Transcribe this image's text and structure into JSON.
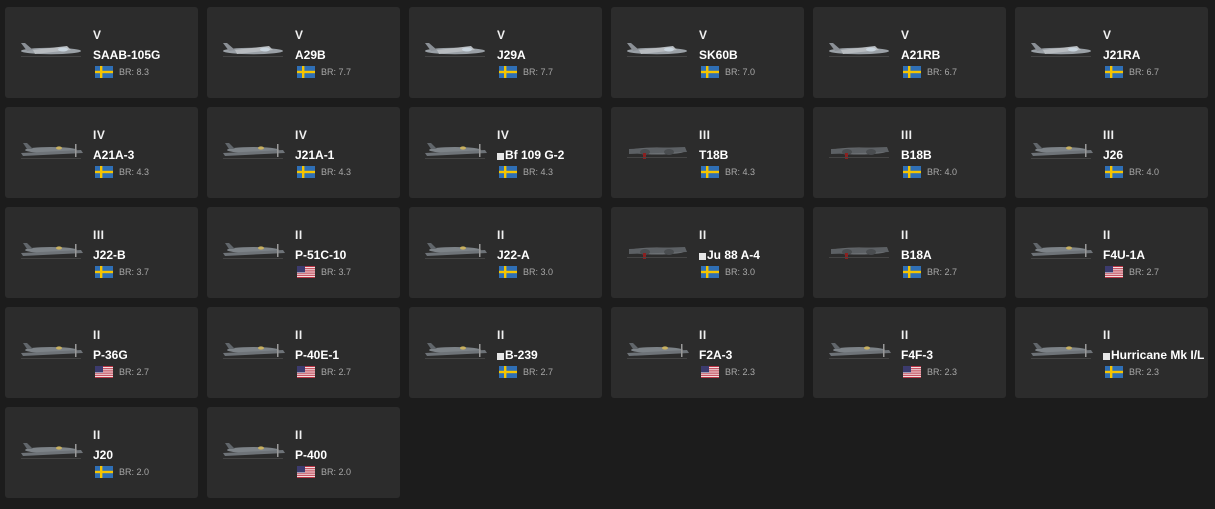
{
  "vehicles": [
    {
      "rank": "V",
      "name": "SAAB-105G",
      "premium": false,
      "flag": "sweden-flag-icon",
      "br": "BR: 8.3",
      "plane": "jet-icon"
    },
    {
      "rank": "V",
      "name": "A29B",
      "premium": false,
      "flag": "sweden-flag-icon",
      "br": "BR: 7.7",
      "plane": "jet-icon"
    },
    {
      "rank": "V",
      "name": "J29A",
      "premium": false,
      "flag": "sweden-flag-icon",
      "br": "BR: 7.7",
      "plane": "jet-icon"
    },
    {
      "rank": "V",
      "name": "SK60B",
      "premium": false,
      "flag": "sweden-flag-icon",
      "br": "BR: 7.0",
      "plane": "jet-icon"
    },
    {
      "rank": "V",
      "name": "A21RB",
      "premium": false,
      "flag": "sweden-flag-icon",
      "br": "BR: 6.7",
      "plane": "jet-icon"
    },
    {
      "rank": "V",
      "name": "J21RA",
      "premium": false,
      "flag": "sweden-flag-icon",
      "br": "BR: 6.7",
      "plane": "jet-icon"
    },
    {
      "rank": "IV",
      "name": "A21A-3",
      "premium": false,
      "flag": "sweden-flag-icon",
      "br": "BR: 4.3",
      "plane": "prop-plane-icon"
    },
    {
      "rank": "IV",
      "name": "J21A-1",
      "premium": false,
      "flag": "sweden-flag-icon",
      "br": "BR: 4.3",
      "plane": "prop-plane-icon"
    },
    {
      "rank": "IV",
      "name": "Bf 109 G-2",
      "premium": true,
      "flag": "sweden-flag-icon",
      "br": "BR: 4.3",
      "plane": "prop-plane-icon"
    },
    {
      "rank": "III",
      "name": "T18B",
      "premium": false,
      "flag": "sweden-flag-icon",
      "br": "BR: 4.3",
      "plane": "twin-engine-icon"
    },
    {
      "rank": "III",
      "name": "B18B",
      "premium": false,
      "flag": "sweden-flag-icon",
      "br": "BR: 4.0",
      "plane": "twin-engine-icon"
    },
    {
      "rank": "III",
      "name": "J26",
      "premium": false,
      "flag": "sweden-flag-icon",
      "br": "BR: 4.0",
      "plane": "prop-plane-icon"
    },
    {
      "rank": "III",
      "name": "J22-B",
      "premium": false,
      "flag": "sweden-flag-icon",
      "br": "BR: 3.7",
      "plane": "prop-plane-icon"
    },
    {
      "rank": "II",
      "name": "P-51C-10",
      "premium": false,
      "flag": "usa-flag-icon",
      "br": "BR: 3.7",
      "plane": "prop-plane-icon"
    },
    {
      "rank": "II",
      "name": "J22-A",
      "premium": false,
      "flag": "sweden-flag-icon",
      "br": "BR: 3.0",
      "plane": "prop-plane-icon"
    },
    {
      "rank": "II",
      "name": "Ju 88 A-4",
      "premium": true,
      "flag": "sweden-flag-icon",
      "br": "BR: 3.0",
      "plane": "twin-engine-icon"
    },
    {
      "rank": "II",
      "name": "B18A",
      "premium": false,
      "flag": "sweden-flag-icon",
      "br": "BR: 2.7",
      "plane": "twin-engine-icon"
    },
    {
      "rank": "II",
      "name": "F4U-1A",
      "premium": false,
      "flag": "usa-flag-icon",
      "br": "BR: 2.7",
      "plane": "prop-plane-icon"
    },
    {
      "rank": "II",
      "name": "P-36G",
      "premium": false,
      "flag": "usa-flag-icon",
      "br": "BR: 2.7",
      "plane": "prop-plane-icon"
    },
    {
      "rank": "II",
      "name": "P-40E-1",
      "premium": false,
      "flag": "usa-flag-icon",
      "br": "BR: 2.7",
      "plane": "prop-plane-icon"
    },
    {
      "rank": "II",
      "name": "B-239",
      "premium": true,
      "flag": "sweden-flag-icon",
      "br": "BR: 2.7",
      "plane": "prop-plane-icon"
    },
    {
      "rank": "II",
      "name": "F2A-3",
      "premium": false,
      "flag": "usa-flag-icon",
      "br": "BR: 2.3",
      "plane": "prop-plane-icon"
    },
    {
      "rank": "II",
      "name": "F4F-3",
      "premium": false,
      "flag": "usa-flag-icon",
      "br": "BR: 2.3",
      "plane": "prop-plane-icon"
    },
    {
      "rank": "II",
      "name": "Hurricane Mk I/L",
      "premium": true,
      "flag": "sweden-flag-icon",
      "br": "BR: 2.3",
      "plane": "prop-plane-icon"
    },
    {
      "rank": "II",
      "name": "J20",
      "premium": false,
      "flag": "sweden-flag-icon",
      "br": "BR: 2.0",
      "plane": "prop-plane-icon"
    },
    {
      "rank": "II",
      "name": "P-400",
      "premium": false,
      "flag": "usa-flag-icon",
      "br": "BR: 2.0",
      "plane": "prop-plane-icon"
    }
  ],
  "colors": {
    "background": "#1c1c1c",
    "card": "#2c2c2c",
    "sweden_blue": "#2f6fb5",
    "sweden_yellow": "#f5c400",
    "usa_red": "#b22234",
    "usa_blue": "#3c3b6e"
  }
}
